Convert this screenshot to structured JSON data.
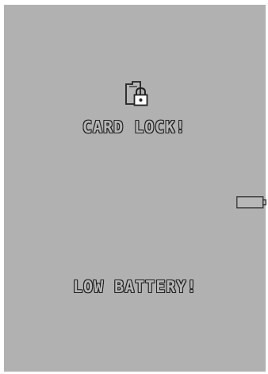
{
  "display": {
    "background_color": "#b1b1b1"
  },
  "warnings": {
    "card_lock": {
      "icon": "card-lock-icon",
      "text": "CARD LOCK!"
    },
    "low_battery": {
      "icon": "battery-empty-icon",
      "text": "LOW BATTERY!"
    }
  }
}
